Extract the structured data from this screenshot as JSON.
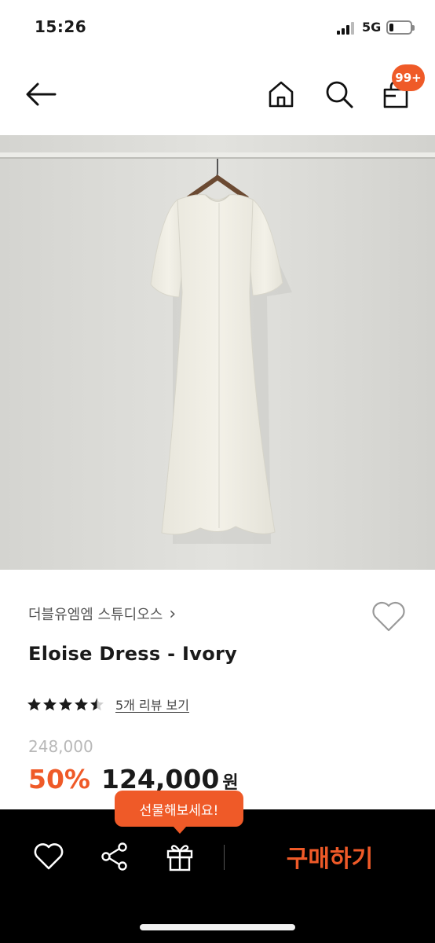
{
  "status_bar": {
    "time": "15:26",
    "network": "5G",
    "battery_level": 0.2
  },
  "header": {
    "back_icon": "arrow-left-icon",
    "home_icon": "home-icon",
    "search_icon": "search-icon",
    "cart_icon": "shopping-bag-icon",
    "cart_badge": "99+"
  },
  "product": {
    "image_alt_icon": "dress-photo",
    "brand": "더블유엠엠 스튜디오스",
    "brand_chevron": "›",
    "title": "Eloise Dress - Ivory",
    "rating": 4.5,
    "review_link": "5개 리뷰 보기",
    "original_price": "248,000",
    "discount": "50%",
    "sale_price": "124,000",
    "currency": "원"
  },
  "bottom_bar": {
    "wishlist_icon": "heart-icon",
    "share_icon": "share-icon",
    "gift_icon": "gift-icon",
    "gift_tooltip": "선물해보세요!",
    "buy_label": "구매하기"
  },
  "colors": {
    "accent": "#ef5a28",
    "bar_background": "#000000",
    "text": "#1a1a1a",
    "muted": "#b8b8b8"
  }
}
